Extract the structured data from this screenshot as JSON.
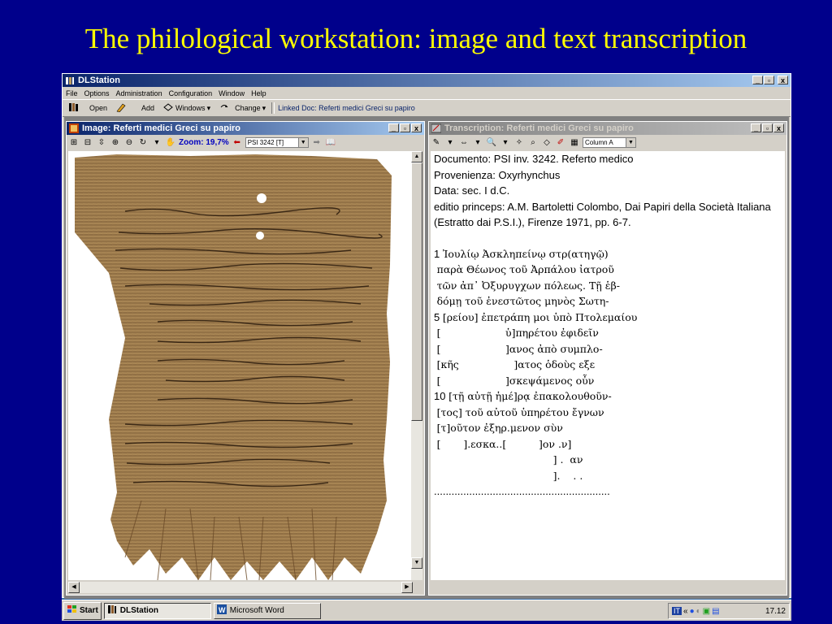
{
  "slide": {
    "title": "The philological workstation: image and text transcription"
  },
  "app": {
    "title": "DLStation"
  },
  "window_buttons": {
    "min": "_",
    "max": "▫",
    "close": "x"
  },
  "menu": [
    "File",
    "Options",
    "Administration",
    "Configuration",
    "Window",
    "Help"
  ],
  "toolbar": {
    "open": "Open",
    "add": "Add",
    "windows": "Windows",
    "change": "Change",
    "linked_doc": "Linked Doc: Referti medici Greci su papiro"
  },
  "image_window": {
    "title": "Image: Referti medici Greci su papiro",
    "zoom": "Zoom: 19,7%",
    "page_select": "PSI 3242 [T]"
  },
  "transcription_window": {
    "title": "Transcription: Referti medici Greci su papiro",
    "column_select": "Column A",
    "header": [
      "Documento: PSI inv. 3242. Referto medico",
      "Provenienza: Oxyrhynchus",
      "Data: sec. I d.C.",
      "editio princeps:  A.M. Bartoletti Colombo, Dai Papiri della Società Italiana",
      "(Estratto dai P.S.I.), Firenze 1971, pp. 6-7."
    ],
    "lines": [
      {
        "num": "1",
        "text": "Ἰουλίῳ Ἀσκληπείνῳ στρ(ατηγῷ)"
      },
      {
        "num": "",
        "text": "παρὰ Θέωνος τοῦ Ἀρπάλου ἰατροῦ"
      },
      {
        "num": "",
        "text": "τῶν ἀπ᾽ Ὀξυρυγχων πόλεως. Τῇ ἑβ-"
      },
      {
        "num": "",
        "text": "δόμῃ τοῦ ἐνεστῶτος μηνὸς Σωτη-"
      },
      {
        "num": "5",
        "text": "[ρείου] ἐπετράπη μοι ὑπὸ Πτολεμαίου"
      },
      {
        "num": "",
        "text": "[                    ὑ]πηρέτου ἐφιδεῖν"
      },
      {
        "num": "",
        "text": "[                    ]ανος ἀπὸ συμπλο-"
      },
      {
        "num": "",
        "text": "[κῆς                 ]ατος ὁδοὺς εξε"
      },
      {
        "num": "",
        "text": "[                    ]σκεψάμενος οὖν"
      },
      {
        "num": "10",
        "text": "[τῇ αὐτῇ ἡμέ]ρᾳ ἐπακολουθοῦν-"
      },
      {
        "num": "",
        "text": "[τος] τοῦ αὐτοῦ ὑπηρέτου ἔγνων"
      },
      {
        "num": "",
        "text": "[τ]οῦτον ἐξηρ.μενον σὺν"
      },
      {
        "num": "",
        "text": "[       ].εσκα..[          ]ον .ν]"
      },
      {
        "num": "",
        "text": "                                    ] .  αν"
      },
      {
        "num": "",
        "text": "                                    ].    . ."
      }
    ],
    "dots": "............................................................"
  },
  "taskbar": {
    "start": "Start",
    "tasks": [
      "DLStation",
      "Microsoft Word"
    ],
    "tray_label": "IT",
    "tray_arrows": "«",
    "clock": "17.12"
  },
  "colors": {
    "slide_bg": "#00008b",
    "title": "#ffff00",
    "titlebar_active": "#0a246a",
    "chrome": "#d4d0c8",
    "papyrus": "#9c7a4c"
  }
}
